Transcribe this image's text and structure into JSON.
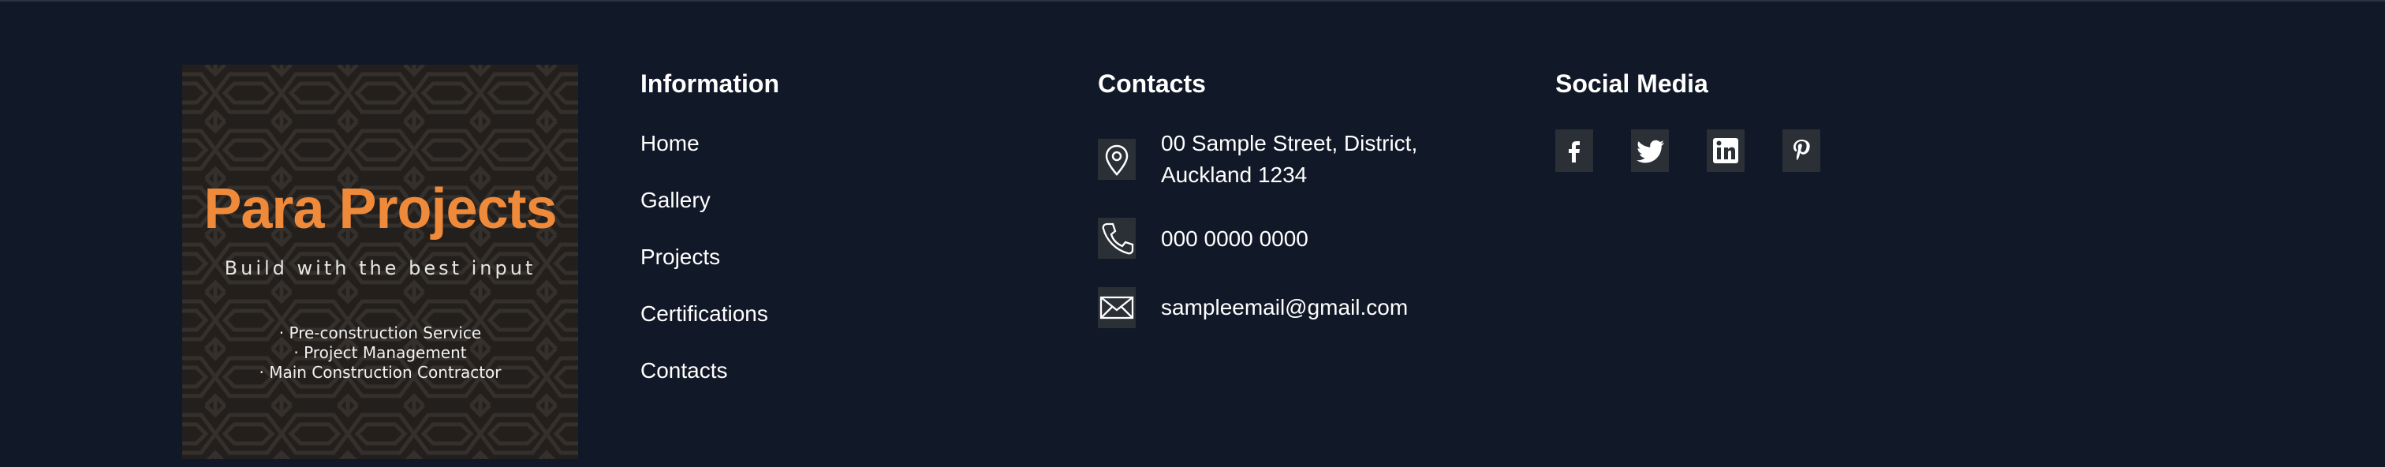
{
  "logo": {
    "title": "Para Projects",
    "tagline": "Build with the best input",
    "services": [
      "· Pre-construction Service",
      "· Project Management",
      "· Main Construction Contractor"
    ],
    "title_color": "#ef8a3b"
  },
  "information": {
    "title": "Information",
    "links": [
      "Home",
      "Gallery",
      "Projects",
      "Certifications",
      "Contacts"
    ]
  },
  "contacts": {
    "title": "Contacts",
    "address_line1": "00 Sample Street, District,",
    "address_line2": "Auckland 1234",
    "phone": "000 0000 0000",
    "email": "sampleemail@gmail.com",
    "icons": [
      "location-pin-icon",
      "phone-icon",
      "envelope-icon"
    ]
  },
  "social": {
    "title": "Social Media",
    "icons": [
      "facebook-icon",
      "twitter-icon",
      "linkedin-icon",
      "pinterest-icon"
    ]
  },
  "colors": {
    "background": "#111827",
    "icon_tile": "#2b2f36",
    "accent": "#ef8a3b"
  }
}
